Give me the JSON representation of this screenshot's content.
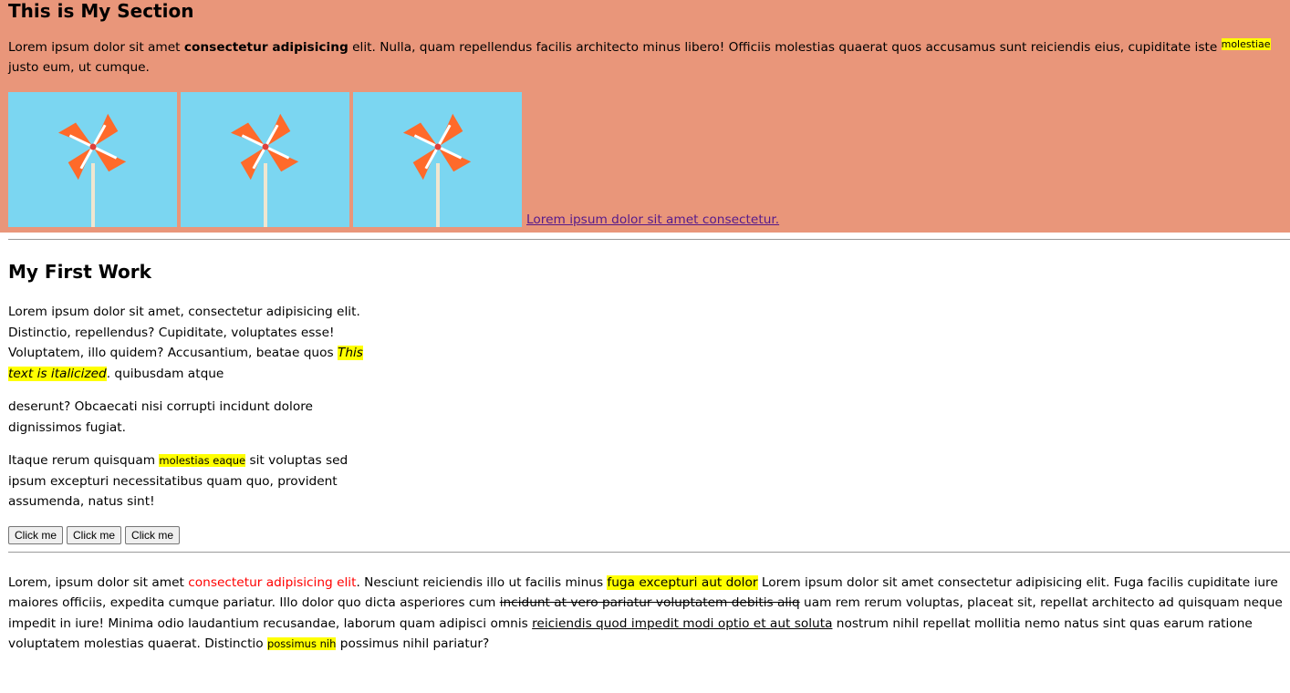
{
  "section": {
    "title": "This is My Section",
    "para_pre": "Lorem ipsum dolor sit amet ",
    "para_bold": "consectetur adipisicing",
    "para_mid": " elit. Nulla, quam repellendus facilis architecto minus libero! Officiis molestias quaerat quos accusamus sunt reiciendis eius, cupiditate iste ",
    "para_mark": "molestiae",
    "para_post": " justo eum, ut cumque.",
    "image_icon": "pinwheel-image",
    "link_text": "Lorem ipsum dolor sit amet consectetur.",
    "bg_color": "#e9967a",
    "tile_color": "#7bd6f1"
  },
  "work": {
    "title": "My First Work",
    "p1_pre": "Lorem ipsum dolor sit amet, consectetur adipisicing elit. Distinctio, repellendus? Cupiditate, voluptates esse! Voluptatem, illo quidem? Accusantium, beatae quos ",
    "p1_italic": "This text is italicized",
    "p1_post": ". quibusdam atque",
    "p2": "deserunt? Obcaecati nisi corrupti incidunt dolore dignissimos fugiat.",
    "p3_pre": "Itaque rerum quisquam ",
    "p3_mark": "molestias eaque",
    "p3_post": " sit voluptas sed ipsum excepturi necessitatibus quam quo, provident assumenda, natus sint!",
    "buttons": [
      "Click me",
      "Click me",
      "Click me"
    ]
  },
  "bottom": {
    "s1": "Lorem, ipsum dolor sit amet ",
    "red": "consectetur adipisicing elit",
    "s2": ". Nesciunt reiciendis illo ut facilis minus ",
    "mark1": "fuga excepturi aut dolor",
    "s3": " Lorem ipsum dolor sit amet consectetur adipisicing elit. Fuga facilis cupiditate iure maiores officiis, expedita cumque pariatur. Illo dolor quo dicta asperiores cum ",
    "strike": "incidunt at vero pariatur voluptatem debitis aliq",
    "s4": " uam rem rerum voluptas, placeat sit, repellat architecto ad quisquam neque impedit in iure! Minima odio laudantium recusandae, laborum quam adipisci omnis ",
    "under": "reiciendis quod impedit modi optio et aut soluta",
    "s5": " nostrum nihil repellat mollitia nemo natus sint quas earum ratione voluptatem molestias quaerat. Distinctio ",
    "mark2": "possimus nih",
    "s6": " possimus nihil pariatur?",
    "highlight_color": "#ffff00",
    "red_color": "#ff0000"
  }
}
